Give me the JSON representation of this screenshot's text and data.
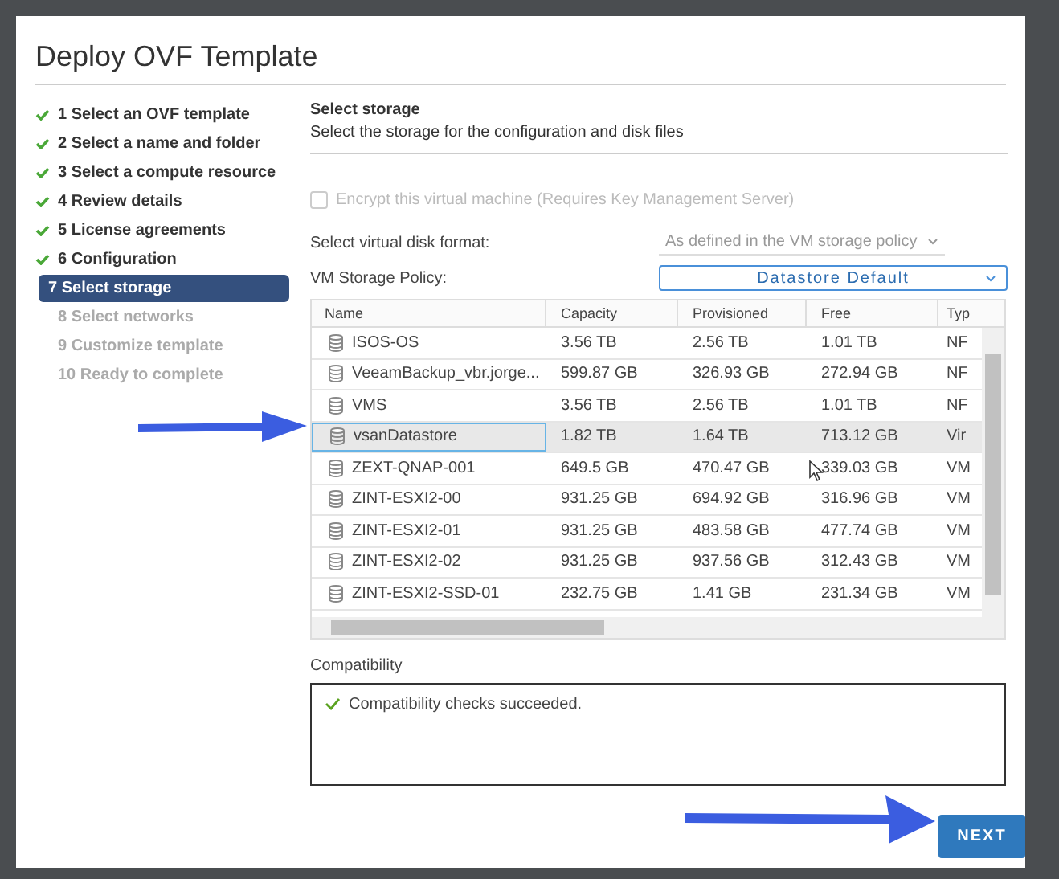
{
  "window": {
    "title": "Deploy OVF Template"
  },
  "steps": [
    {
      "label": "1 Select an OVF template",
      "completed": true,
      "selected": false
    },
    {
      "label": "2 Select a name and folder",
      "completed": true,
      "selected": false
    },
    {
      "label": "3 Select a compute resource",
      "completed": true,
      "selected": false
    },
    {
      "label": "4 Review details",
      "completed": true,
      "selected": false
    },
    {
      "label": "5 License agreements",
      "completed": true,
      "selected": false
    },
    {
      "label": "6 Configuration",
      "completed": true,
      "selected": false
    },
    {
      "label": "7 Select storage",
      "completed": false,
      "selected": true
    },
    {
      "label": "8 Select networks",
      "completed": false,
      "selected": false
    },
    {
      "label": "9 Customize template",
      "completed": false,
      "selected": false
    },
    {
      "label": "10 Ready to complete",
      "completed": false,
      "selected": false
    }
  ],
  "section": {
    "title": "Select storage",
    "subtitle": "Select the storage for the configuration and disk files"
  },
  "encrypt": {
    "label": "Encrypt this virtual machine (Requires Key Management Server)",
    "checked": false,
    "disabled": true
  },
  "disk_format": {
    "label": "Select virtual disk format:",
    "value": "As defined in the VM storage policy",
    "disabled": true
  },
  "storage_policy": {
    "label": "VM Storage Policy:",
    "value": "Datastore Default"
  },
  "table": {
    "columns": [
      "Name",
      "Capacity",
      "Provisioned",
      "Free",
      "Typ"
    ],
    "rows": [
      {
        "cells": [
          "ISOS-OS",
          "3.56 TB",
          "2.56 TB",
          "1.01 TB",
          "NF"
        ],
        "selected": false
      },
      {
        "cells": [
          "VeeamBackup_vbr.jorge...",
          "599.87 GB",
          "326.93 GB",
          "272.94 GB",
          "NF"
        ],
        "selected": false
      },
      {
        "cells": [
          "VMS",
          "3.56 TB",
          "2.56 TB",
          "1.01 TB",
          "NF"
        ],
        "selected": false
      },
      {
        "cells": [
          "vsanDatastore",
          "1.82 TB",
          "1.64 TB",
          "713.12 GB",
          "Vir"
        ],
        "selected": true
      },
      {
        "cells": [
          "ZEXT-QNAP-001",
          "649.5 GB",
          "470.47 GB",
          "339.03 GB",
          "VM"
        ],
        "selected": false
      },
      {
        "cells": [
          "ZINT-ESXI2-00",
          "931.25 GB",
          "694.92 GB",
          "316.96 GB",
          "VM"
        ],
        "selected": false
      },
      {
        "cells": [
          "ZINT-ESXI2-01",
          "931.25 GB",
          "483.58 GB",
          "477.74 GB",
          "VM"
        ],
        "selected": false
      },
      {
        "cells": [
          "ZINT-ESXI2-02",
          "931.25 GB",
          "937.56 GB",
          "312.43 GB",
          "VM"
        ],
        "selected": false
      },
      {
        "cells": [
          "ZINT-ESXI2-SSD-01",
          "232.75 GB",
          "1.41 GB",
          "231.34 GB",
          "VM"
        ],
        "selected": false
      }
    ]
  },
  "compatibility": {
    "label": "Compatibility",
    "message": "Compatibility checks succeeded."
  },
  "buttons": {
    "next": "NEXT"
  }
}
